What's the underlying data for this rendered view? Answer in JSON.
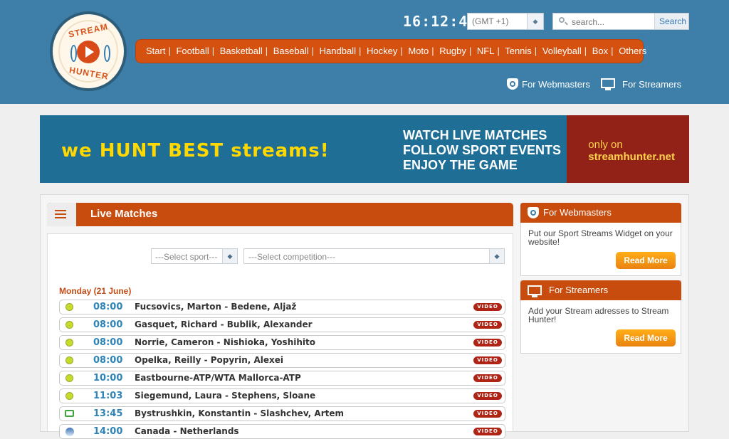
{
  "header": {
    "clock": "16:12:43",
    "timezone": "(GMT +1)",
    "search": {
      "placeholder": "search...",
      "button": "Search"
    },
    "nav": [
      "Start",
      "Football",
      "Basketball",
      "Baseball",
      "Handball",
      "Hockey",
      "Moto",
      "Rugby",
      "NFL",
      "Tennis",
      "Volleyball",
      "Box",
      "Others"
    ],
    "links": {
      "webmasters": "For Webmasters",
      "streamers": "For Streamers"
    },
    "logo": {
      "top": "STREAM",
      "bottom": "HUNTER"
    }
  },
  "banner": {
    "tagline": "we HUNT BEST streams!",
    "lines": [
      "WATCH LIVE MATCHES",
      "FOLLOW SPORT EVENTS",
      "ENJOY THE GAME"
    ],
    "only_on": "only on",
    "site": "streamhunter.net"
  },
  "live": {
    "title": "Live Matches",
    "filters": {
      "sport": "---Select sport---",
      "competition": "---Select competition---"
    },
    "day": "Monday (21 June)",
    "video_label": "VIDEO",
    "matches": [
      {
        "time": "08:00",
        "title": "Fucsovics, Marton - Bedene, Aljaž",
        "icon": "tennis-ball-icon"
      },
      {
        "time": "08:00",
        "title": "Gasquet, Richard - Bublik, Alexander",
        "icon": "tennis-ball-icon"
      },
      {
        "time": "08:00",
        "title": "Norrie, Cameron - Nishioka, Yoshihito",
        "icon": "tennis-ball-icon"
      },
      {
        "time": "08:00",
        "title": "Opelka, Reilly - Popyrin, Alexei",
        "icon": "tennis-ball-icon"
      },
      {
        "time": "10:00",
        "title": "Eastbourne-ATP/WTA Mallorca-ATP",
        "icon": "tennis-ball-icon"
      },
      {
        "time": "11:03",
        "title": "Siegemund, Laura - Stephens, Sloane",
        "icon": "tennis-ball-icon"
      },
      {
        "time": "13:45",
        "title": "Bystrushkin, Konstantin - Slashchev, Artem",
        "icon": "tv-icon"
      },
      {
        "time": "14:00",
        "title": "Canada - Netherlands",
        "icon": "volleyball-icon"
      }
    ]
  },
  "sidebar": {
    "webmasters": {
      "title": "For Webmasters",
      "text": "Put our Sport Streams Widget on your website!",
      "button": "Read More"
    },
    "streamers": {
      "title": "For Streamers",
      "text": "Add your Stream adresses to Stream Hunter!",
      "button": "Read More"
    }
  },
  "colors": {
    "header": "#3d7fa9",
    "accent": "#c94c0f",
    "button": "#f39a13"
  }
}
